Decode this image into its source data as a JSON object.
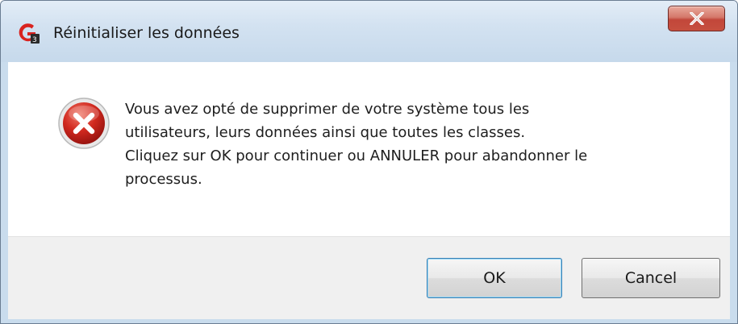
{
  "window": {
    "title": "Réinitialiser les données",
    "app_icon": "gradebook-app-icon",
    "close_icon": "close-x-icon"
  },
  "dialog": {
    "icon": "error-icon",
    "message_lines": [
      "Vous avez opté de supprimer de votre système tous les",
      "utilisateurs, leurs données ainsi que toutes les classes.",
      "Cliquez sur OK pour continuer ou ANNULER pour abandonner le",
      "processus."
    ]
  },
  "buttons": {
    "ok_label": "OK",
    "cancel_label": "Cancel"
  },
  "colors": {
    "title_bar": "#c6d9eb",
    "close_button": "#c64f3f",
    "error_icon": "#c8201d",
    "footer": "#f0f0f0"
  }
}
